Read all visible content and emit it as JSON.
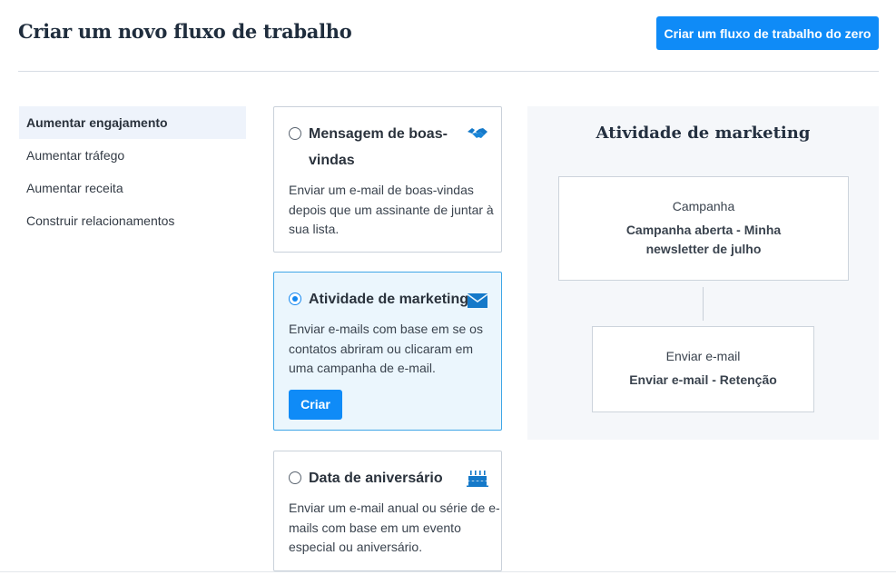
{
  "header": {
    "title": "Criar um novo fluxo de trabalho",
    "create_from_scratch_label": "Criar um fluxo de trabalho do zero"
  },
  "sidebar": {
    "items": [
      {
        "label": "Aumentar engajamento",
        "active": true
      },
      {
        "label": "Aumentar tráfego",
        "active": false
      },
      {
        "label": "Aumentar receita",
        "active": false
      },
      {
        "label": "Construir relacionamentos",
        "active": false
      }
    ]
  },
  "templates": [
    {
      "title": "Mensagem de boas-vindas",
      "description": "Enviar um e-mail de boas-vindas depois que um assinante de juntar à sua lista.",
      "icon": "handshake-icon",
      "selected": false
    },
    {
      "title": "Atividade de marketing",
      "description": "Enviar e-mails com base em se os contatos abriram ou clicaram em uma campanha de e-mail.",
      "icon": "envelope-icon",
      "selected": true,
      "button_label": "Criar"
    },
    {
      "title": "Data de aniversário",
      "description": "Enviar um e-mail anual ou série de e-mails com base em um evento especial ou aniversário.",
      "icon": "birthday-cake-icon",
      "selected": false
    }
  ],
  "preview": {
    "title": "Atividade de marketing",
    "nodes": [
      {
        "label": "Campanha",
        "value": "Campanha aberta - Minha newsletter de julho"
      },
      {
        "label": "Enviar e-mail",
        "value": "Enviar e-mail - Retenção"
      }
    ]
  },
  "colors": {
    "primary": "#0f8bf7",
    "selected_bg": "#ebf6fd",
    "selected_border": "#3fa6e7",
    "icon": "#1579c9"
  }
}
